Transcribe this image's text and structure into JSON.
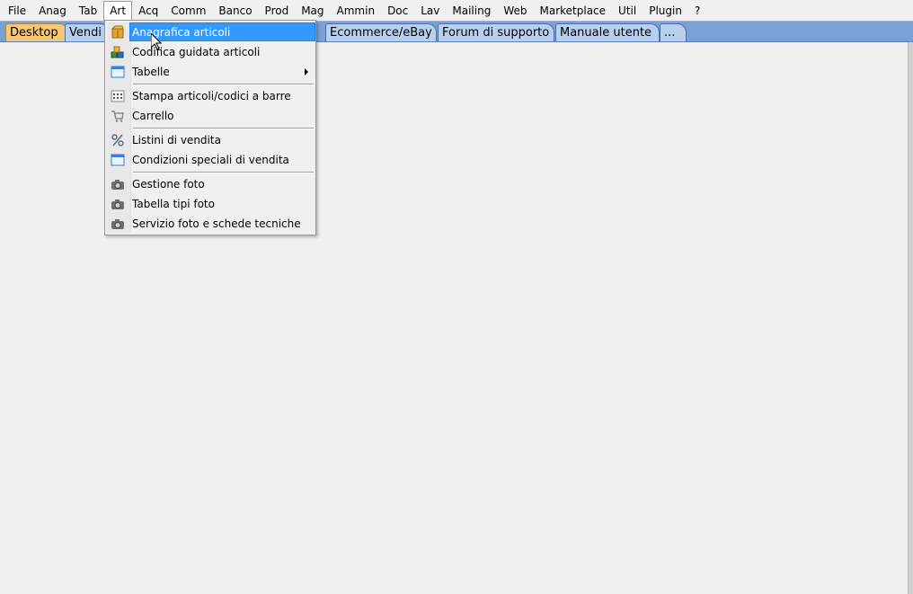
{
  "menubar": {
    "items": [
      "File",
      "Anag",
      "Tab",
      "Art",
      "Acq",
      "Comm",
      "Banco",
      "Prod",
      "Mag",
      "Ammin",
      "Doc",
      "Lav",
      "Mailing",
      "Web",
      "Marketplace",
      "Util",
      "Plugin",
      "?"
    ],
    "open_item": "Art"
  },
  "tabs": {
    "items": [
      "Desktop",
      "Vendi",
      "Ecommerce/eBay",
      "Forum di supporto",
      "Manuale utente",
      "..."
    ],
    "active": "Desktop"
  },
  "art_menu": {
    "items": [
      {
        "label": "Anagrafica articoli",
        "icon": "package-icon",
        "highlighted": true
      },
      {
        "label": "Codifica guidata articoli",
        "icon": "cubes-icon"
      },
      {
        "label": "Tabelle",
        "icon": "table-icon",
        "submenu": true
      },
      {
        "label": "Stampa articoli/codici a barre",
        "icon": "barcode-print-icon"
      },
      {
        "label": "Carrello",
        "icon": "cart-icon"
      },
      {
        "label": "Listini di vendita",
        "icon": "percent-icon"
      },
      {
        "label": "Condizioni speciali di vendita",
        "icon": "window-icon"
      },
      {
        "label": "Gestione foto",
        "icon": "camera-icon"
      },
      {
        "label": "Tabella tipi foto",
        "icon": "camera-icon"
      },
      {
        "label": "Servizio foto e schede tecniche",
        "icon": "camera-icon"
      }
    ]
  },
  "colors": {
    "tabstrip": "#7aa0d6",
    "tab": "#b9cff0",
    "active_tab": "#f6c777",
    "highlight": "#3399ff",
    "background": "#f0f0f0"
  }
}
